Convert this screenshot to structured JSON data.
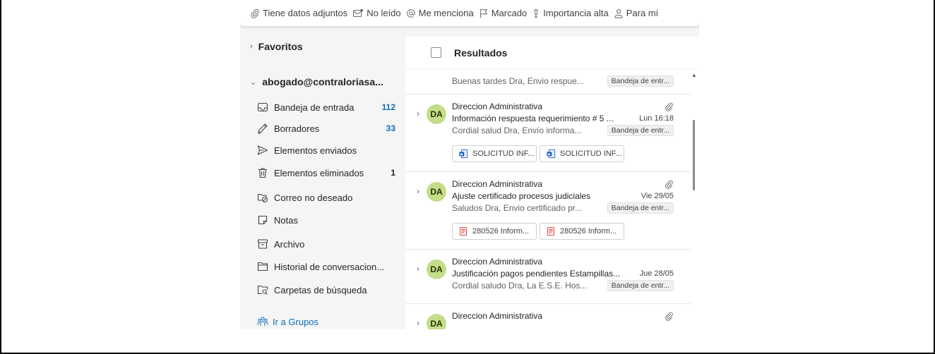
{
  "filters": [
    {
      "label": "Tiene datos adjuntos",
      "icon": "paperclip-icon"
    },
    {
      "label": "No leído",
      "icon": "unread-mail-icon"
    },
    {
      "label": "Me menciona",
      "icon": "at-sign-icon"
    },
    {
      "label": "Marcado",
      "icon": "flag-icon"
    },
    {
      "label": "Importancia alta",
      "icon": "importance-icon"
    },
    {
      "label": "Para mí",
      "icon": "person-icon"
    }
  ],
  "sidebar": {
    "favorites_label": "Favoritos",
    "account_label": "abogado@contraloriasa...",
    "folders": [
      {
        "label": "Bandeja de entrada",
        "count": "112",
        "icon": "inbox-icon"
      },
      {
        "label": "Borradores",
        "count": "33",
        "icon": "drafts-icon"
      },
      {
        "label": "Elementos enviados",
        "count": "",
        "icon": "sent-icon"
      },
      {
        "label": "Elementos eliminados",
        "count": "1",
        "icon": "trash-icon"
      },
      {
        "label": "Correo no deseado",
        "count": "",
        "icon": "junk-icon"
      },
      {
        "label": "Notas",
        "count": "",
        "icon": "notes-icon"
      },
      {
        "label": "Archivo",
        "count": "",
        "icon": "archive-icon"
      },
      {
        "label": "Historial de conversacion...",
        "count": "",
        "icon": "history-folder-icon"
      },
      {
        "label": "Carpetas de búsqueda",
        "count": "",
        "icon": "search-folder-icon"
      }
    ],
    "groups_link": "Ir a Grupos"
  },
  "list": {
    "title": "Resultados",
    "partial_preview": "Buenas tardes Dra, Envio respue...",
    "partial_tag": "Bandeja de entr...",
    "messages": [
      {
        "avatar": "DA",
        "sender": "Direccion Administrativa",
        "subject": "Información respuesta requerimiento # 5 ...",
        "date": "Lun 16:18",
        "preview": "Cordial salud Dra, Envío informa...",
        "tag": "Bandeja de entr...",
        "has_attachment": true,
        "attachments": [
          {
            "name": "SOLICITUD INF...",
            "icon": "word-doc-icon"
          },
          {
            "name": "SOLICITUD INF...",
            "icon": "word-doc-icon"
          }
        ]
      },
      {
        "avatar": "DA",
        "sender": "Direccion Administrativa",
        "subject": "Ajuste certificado procesos judiciales",
        "date": "Vie 29/05",
        "preview": "Saludos Dra, Envio certificado pr...",
        "tag": "Bandeja de entr...",
        "has_attachment": true,
        "attachments": [
          {
            "name": "280526 Inform...",
            "icon": "pdf-icon"
          },
          {
            "name": "280526 Inform...",
            "icon": "pdf-icon"
          }
        ]
      },
      {
        "avatar": "DA",
        "sender": "Direccion Administrativa",
        "subject": "Justificación pagos pendientes Estampillas...",
        "date": "Jue 28/05",
        "preview": "Cordial saludo Dra, La E.S.E. Hos...",
        "tag": "Bandeja de entr...",
        "has_attachment": false,
        "attachments": []
      },
      {
        "avatar": "DA",
        "sender": "Direccion Administrativa",
        "subject": "",
        "date": "",
        "preview": "",
        "tag": "",
        "has_attachment": true,
        "attachments": []
      }
    ]
  },
  "colors": {
    "accent": "#0f6cbd",
    "avatar_bg": "#c4dd89",
    "sidebar_bg": "#f5f5f5"
  }
}
